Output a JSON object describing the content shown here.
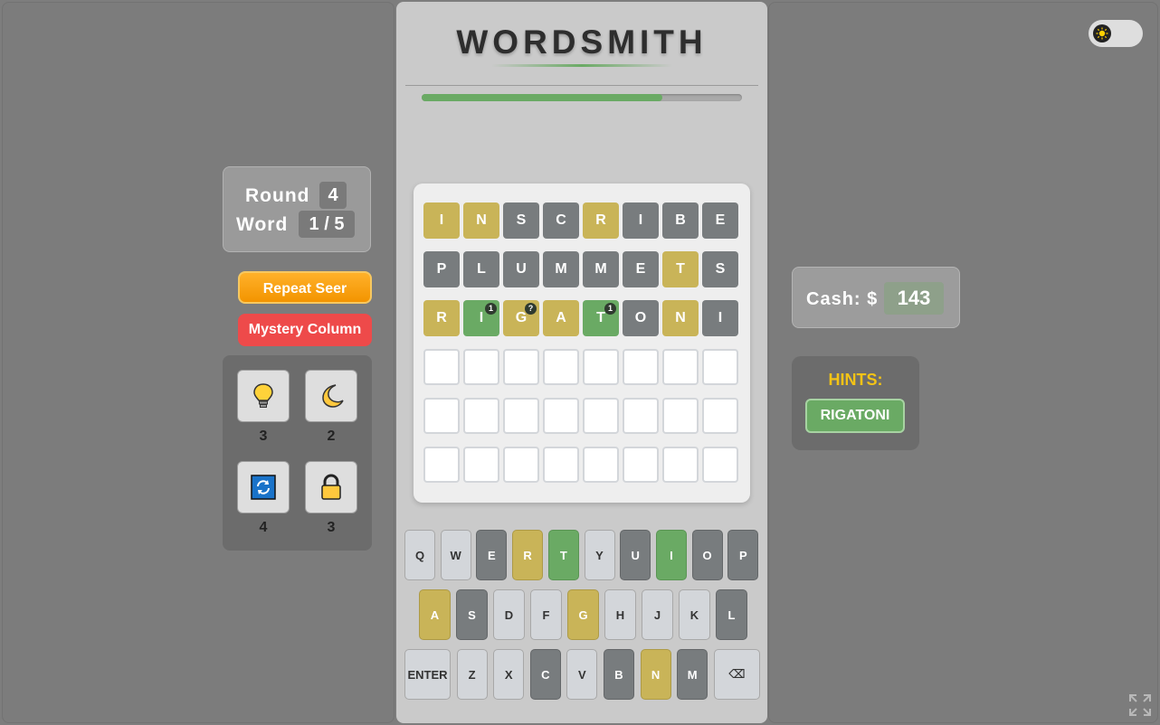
{
  "game": {
    "title": "WORDSMITH",
    "progress": 0.75
  },
  "round": {
    "round_label": "Round",
    "round_value": "4",
    "word_label": "Word",
    "word_value": "1 / 5"
  },
  "powerups": {
    "repeat_seer": "Repeat Seer",
    "mystery_column": "Mystery Column"
  },
  "tools": [
    {
      "icon": "lightbulb-icon",
      "count": "3"
    },
    {
      "icon": "moon-icon",
      "count": "2"
    },
    {
      "icon": "refresh-icon",
      "count": "4"
    },
    {
      "icon": "lock-icon",
      "count": "3"
    }
  ],
  "board": {
    "rows": [
      [
        {
          "l": "I",
          "s": "present"
        },
        {
          "l": "N",
          "s": "present"
        },
        {
          "l": "S",
          "s": "absent"
        },
        {
          "l": "C",
          "s": "absent"
        },
        {
          "l": "R",
          "s": "present"
        },
        {
          "l": "I",
          "s": "absent"
        },
        {
          "l": "B",
          "s": "absent"
        },
        {
          "l": "E",
          "s": "absent"
        }
      ],
      [
        {
          "l": "P",
          "s": "absent"
        },
        {
          "l": "L",
          "s": "absent"
        },
        {
          "l": "U",
          "s": "absent"
        },
        {
          "l": "M",
          "s": "absent"
        },
        {
          "l": "M",
          "s": "absent"
        },
        {
          "l": "E",
          "s": "absent"
        },
        {
          "l": "T",
          "s": "present"
        },
        {
          "l": "S",
          "s": "absent"
        }
      ],
      [
        {
          "l": "R",
          "s": "present"
        },
        {
          "l": "I",
          "s": "correct",
          "b": "1"
        },
        {
          "l": "G",
          "s": "present",
          "b": "?"
        },
        {
          "l": "A",
          "s": "present"
        },
        {
          "l": "T",
          "s": "correct",
          "b": "1"
        },
        {
          "l": "O",
          "s": "absent"
        },
        {
          "l": "N",
          "s": "present"
        },
        {
          "l": "I",
          "s": "absent"
        }
      ],
      [
        {
          "l": "",
          "s": "empty"
        },
        {
          "l": "",
          "s": "empty"
        },
        {
          "l": "",
          "s": "empty"
        },
        {
          "l": "",
          "s": "empty"
        },
        {
          "l": "",
          "s": "empty"
        },
        {
          "l": "",
          "s": "empty"
        },
        {
          "l": "",
          "s": "empty"
        },
        {
          "l": "",
          "s": "empty"
        }
      ],
      [
        {
          "l": "",
          "s": "empty"
        },
        {
          "l": "",
          "s": "empty"
        },
        {
          "l": "",
          "s": "empty"
        },
        {
          "l": "",
          "s": "empty"
        },
        {
          "l": "",
          "s": "empty"
        },
        {
          "l": "",
          "s": "empty"
        },
        {
          "l": "",
          "s": "empty"
        },
        {
          "l": "",
          "s": "empty"
        }
      ],
      [
        {
          "l": "",
          "s": "empty"
        },
        {
          "l": "",
          "s": "empty"
        },
        {
          "l": "",
          "s": "empty"
        },
        {
          "l": "",
          "s": "empty"
        },
        {
          "l": "",
          "s": "empty"
        },
        {
          "l": "",
          "s": "empty"
        },
        {
          "l": "",
          "s": "empty"
        },
        {
          "l": "",
          "s": "empty"
        }
      ]
    ]
  },
  "keyboard": {
    "rows": [
      [
        {
          "k": "Q",
          "s": "default"
        },
        {
          "k": "W",
          "s": "default"
        },
        {
          "k": "E",
          "s": "absent"
        },
        {
          "k": "R",
          "s": "present"
        },
        {
          "k": "T",
          "s": "correct"
        },
        {
          "k": "Y",
          "s": "default"
        },
        {
          "k": "U",
          "s": "absent"
        },
        {
          "k": "I",
          "s": "correct"
        },
        {
          "k": "O",
          "s": "absent"
        },
        {
          "k": "P",
          "s": "absent"
        }
      ],
      [
        {
          "k": "A",
          "s": "present"
        },
        {
          "k": "S",
          "s": "absent"
        },
        {
          "k": "D",
          "s": "default"
        },
        {
          "k": "F",
          "s": "default"
        },
        {
          "k": "G",
          "s": "present"
        },
        {
          "k": "H",
          "s": "default"
        },
        {
          "k": "J",
          "s": "default"
        },
        {
          "k": "K",
          "s": "default"
        },
        {
          "k": "L",
          "s": "absent"
        }
      ],
      [
        {
          "k": "ENTER",
          "s": "default"
        },
        {
          "k": "Z",
          "s": "default"
        },
        {
          "k": "X",
          "s": "default"
        },
        {
          "k": "C",
          "s": "absent"
        },
        {
          "k": "V",
          "s": "default"
        },
        {
          "k": "B",
          "s": "absent"
        },
        {
          "k": "N",
          "s": "present"
        },
        {
          "k": "M",
          "s": "absent"
        },
        {
          "k": "⌫",
          "s": "default"
        }
      ]
    ]
  },
  "cash": {
    "label": "Cash: $",
    "value": "143"
  },
  "hints": {
    "title": "HINTS:",
    "items": [
      "RIGATONI"
    ]
  },
  "colors": {
    "correct": "#6aaa64",
    "present": "#c9b458",
    "absent": "#787c7e",
    "accent_orange": "#f39400",
    "accent_red": "#ee4a4a",
    "hints_gold": "#f3c316"
  }
}
